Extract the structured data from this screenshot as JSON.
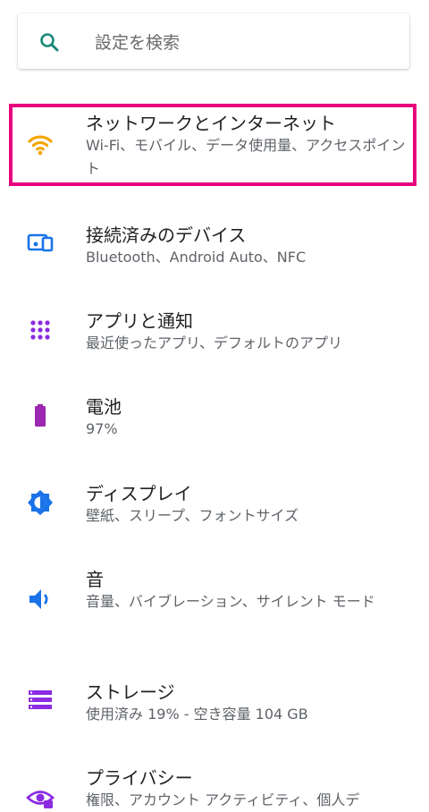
{
  "search": {
    "placeholder": "設定を検索",
    "icon": "search-icon"
  },
  "items": [
    {
      "title": "ネットワークとインターネット",
      "subtitle": "Wi-Fi、モバイル、データ使用量、アクセスポイント",
      "icon": "wifi-icon",
      "color": "#f4a400",
      "highlighted": true
    },
    {
      "title": "接続済みのデバイス",
      "subtitle": "Bluetooth、Android Auto、NFC",
      "icon": "devices-icon",
      "color": "#1a73e8"
    },
    {
      "title": "アプリと通知",
      "subtitle": "最近使ったアプリ、デフォルトのアプリ",
      "icon": "apps-icon",
      "color": "#8b2be2"
    },
    {
      "title": "電池",
      "subtitle": "97%",
      "icon": "battery-icon",
      "color": "#9c27b0"
    },
    {
      "title": "ディスプレイ",
      "subtitle": "壁紙、スリープ、フォントサイズ",
      "icon": "brightness-icon",
      "color": "#1a73e8"
    },
    {
      "title": "音",
      "subtitle": "音量、バイブレーション、サイレント モード",
      "icon": "volume-icon",
      "color": "#1a73e8"
    },
    {
      "title": "ストレージ",
      "subtitle": "使用済み 19% - 空き容量 104 GB",
      "icon": "storage-icon",
      "color": "#8b2be2"
    },
    {
      "title": "プライバシー",
      "subtitle": "権限、アカウント アクティビティ、個人デ",
      "icon": "privacy-eye-icon",
      "color": "#8b2be2"
    }
  ]
}
